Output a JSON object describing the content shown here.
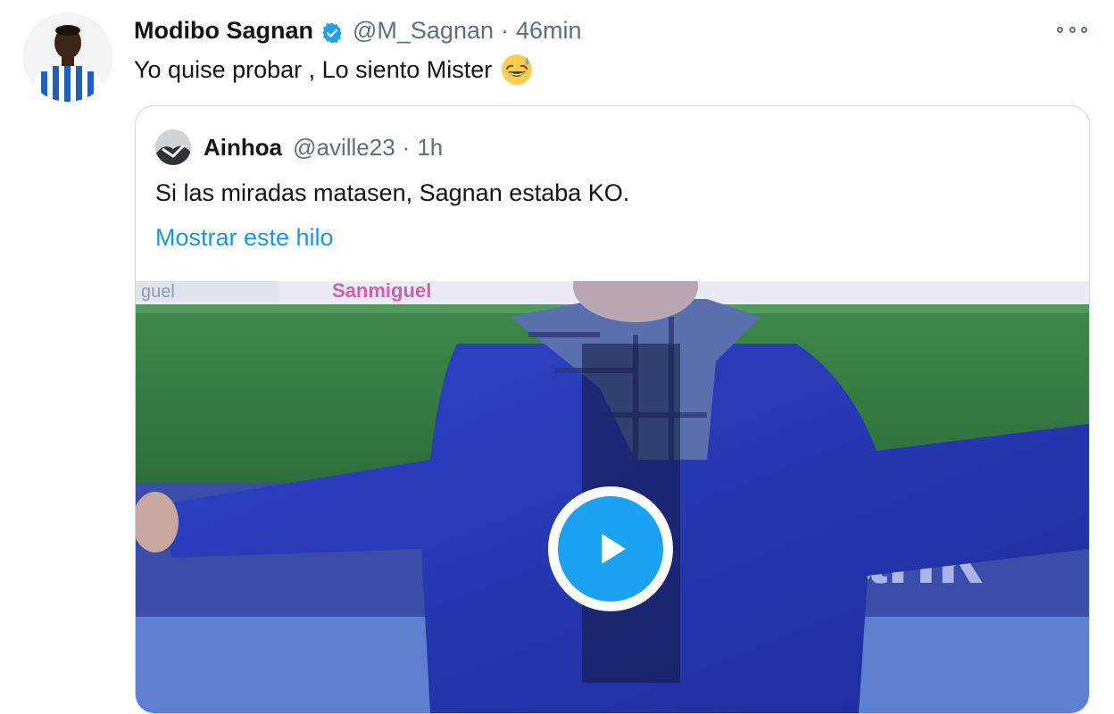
{
  "tweet": {
    "display_name": "Modibo Sagnan",
    "verified_icon": "verified-badge-icon",
    "handle": "@M_Sagnan",
    "separator": "·",
    "time": "46min",
    "text": "Yo quise probar , Lo siento Mister",
    "emoji": "grinning-face-with-sweat-icon",
    "more_icon": "more-options-icon"
  },
  "quoted_tweet": {
    "display_name": "Ainhoa",
    "handle": "@aville23",
    "separator": "·",
    "time": "1h",
    "text": "Si las miradas matasen, Sagnan estaba KO.",
    "show_thread_link": "Mostrar este hilo",
    "media": {
      "type": "video",
      "play_icon": "play-icon",
      "ad_board_text": "ank"
    }
  },
  "colors": {
    "text_primary": "#0f1419",
    "text_secondary": "#5b7083",
    "link": "#1b95e0",
    "accent": "#1da1f2",
    "border": "#cfd9de"
  }
}
